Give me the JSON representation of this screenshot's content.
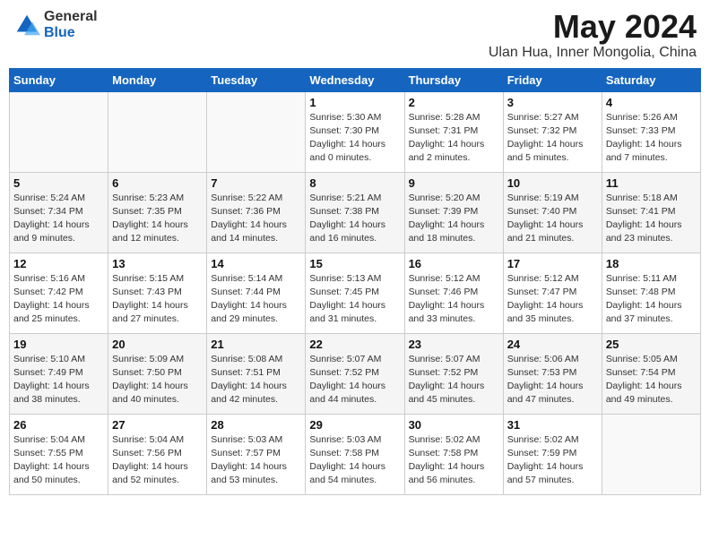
{
  "logo": {
    "general": "General",
    "blue": "Blue"
  },
  "title": "May 2024",
  "location": "Ulan Hua, Inner Mongolia, China",
  "days_header": [
    "Sunday",
    "Monday",
    "Tuesday",
    "Wednesday",
    "Thursday",
    "Friday",
    "Saturday"
  ],
  "weeks": [
    [
      {
        "day": "",
        "info": ""
      },
      {
        "day": "",
        "info": ""
      },
      {
        "day": "",
        "info": ""
      },
      {
        "day": "1",
        "info": "Sunrise: 5:30 AM\nSunset: 7:30 PM\nDaylight: 14 hours\nand 0 minutes."
      },
      {
        "day": "2",
        "info": "Sunrise: 5:28 AM\nSunset: 7:31 PM\nDaylight: 14 hours\nand 2 minutes."
      },
      {
        "day": "3",
        "info": "Sunrise: 5:27 AM\nSunset: 7:32 PM\nDaylight: 14 hours\nand 5 minutes."
      },
      {
        "day": "4",
        "info": "Sunrise: 5:26 AM\nSunset: 7:33 PM\nDaylight: 14 hours\nand 7 minutes."
      }
    ],
    [
      {
        "day": "5",
        "info": "Sunrise: 5:24 AM\nSunset: 7:34 PM\nDaylight: 14 hours\nand 9 minutes."
      },
      {
        "day": "6",
        "info": "Sunrise: 5:23 AM\nSunset: 7:35 PM\nDaylight: 14 hours\nand 12 minutes."
      },
      {
        "day": "7",
        "info": "Sunrise: 5:22 AM\nSunset: 7:36 PM\nDaylight: 14 hours\nand 14 minutes."
      },
      {
        "day": "8",
        "info": "Sunrise: 5:21 AM\nSunset: 7:38 PM\nDaylight: 14 hours\nand 16 minutes."
      },
      {
        "day": "9",
        "info": "Sunrise: 5:20 AM\nSunset: 7:39 PM\nDaylight: 14 hours\nand 18 minutes."
      },
      {
        "day": "10",
        "info": "Sunrise: 5:19 AM\nSunset: 7:40 PM\nDaylight: 14 hours\nand 21 minutes."
      },
      {
        "day": "11",
        "info": "Sunrise: 5:18 AM\nSunset: 7:41 PM\nDaylight: 14 hours\nand 23 minutes."
      }
    ],
    [
      {
        "day": "12",
        "info": "Sunrise: 5:16 AM\nSunset: 7:42 PM\nDaylight: 14 hours\nand 25 minutes."
      },
      {
        "day": "13",
        "info": "Sunrise: 5:15 AM\nSunset: 7:43 PM\nDaylight: 14 hours\nand 27 minutes."
      },
      {
        "day": "14",
        "info": "Sunrise: 5:14 AM\nSunset: 7:44 PM\nDaylight: 14 hours\nand 29 minutes."
      },
      {
        "day": "15",
        "info": "Sunrise: 5:13 AM\nSunset: 7:45 PM\nDaylight: 14 hours\nand 31 minutes."
      },
      {
        "day": "16",
        "info": "Sunrise: 5:12 AM\nSunset: 7:46 PM\nDaylight: 14 hours\nand 33 minutes."
      },
      {
        "day": "17",
        "info": "Sunrise: 5:12 AM\nSunset: 7:47 PM\nDaylight: 14 hours\nand 35 minutes."
      },
      {
        "day": "18",
        "info": "Sunrise: 5:11 AM\nSunset: 7:48 PM\nDaylight: 14 hours\nand 37 minutes."
      }
    ],
    [
      {
        "day": "19",
        "info": "Sunrise: 5:10 AM\nSunset: 7:49 PM\nDaylight: 14 hours\nand 38 minutes."
      },
      {
        "day": "20",
        "info": "Sunrise: 5:09 AM\nSunset: 7:50 PM\nDaylight: 14 hours\nand 40 minutes."
      },
      {
        "day": "21",
        "info": "Sunrise: 5:08 AM\nSunset: 7:51 PM\nDaylight: 14 hours\nand 42 minutes."
      },
      {
        "day": "22",
        "info": "Sunrise: 5:07 AM\nSunset: 7:52 PM\nDaylight: 14 hours\nand 44 minutes."
      },
      {
        "day": "23",
        "info": "Sunrise: 5:07 AM\nSunset: 7:52 PM\nDaylight: 14 hours\nand 45 minutes."
      },
      {
        "day": "24",
        "info": "Sunrise: 5:06 AM\nSunset: 7:53 PM\nDaylight: 14 hours\nand 47 minutes."
      },
      {
        "day": "25",
        "info": "Sunrise: 5:05 AM\nSunset: 7:54 PM\nDaylight: 14 hours\nand 49 minutes."
      }
    ],
    [
      {
        "day": "26",
        "info": "Sunrise: 5:04 AM\nSunset: 7:55 PM\nDaylight: 14 hours\nand 50 minutes."
      },
      {
        "day": "27",
        "info": "Sunrise: 5:04 AM\nSunset: 7:56 PM\nDaylight: 14 hours\nand 52 minutes."
      },
      {
        "day": "28",
        "info": "Sunrise: 5:03 AM\nSunset: 7:57 PM\nDaylight: 14 hours\nand 53 minutes."
      },
      {
        "day": "29",
        "info": "Sunrise: 5:03 AM\nSunset: 7:58 PM\nDaylight: 14 hours\nand 54 minutes."
      },
      {
        "day": "30",
        "info": "Sunrise: 5:02 AM\nSunset: 7:58 PM\nDaylight: 14 hours\nand 56 minutes."
      },
      {
        "day": "31",
        "info": "Sunrise: 5:02 AM\nSunset: 7:59 PM\nDaylight: 14 hours\nand 57 minutes."
      },
      {
        "day": "",
        "info": ""
      }
    ]
  ]
}
